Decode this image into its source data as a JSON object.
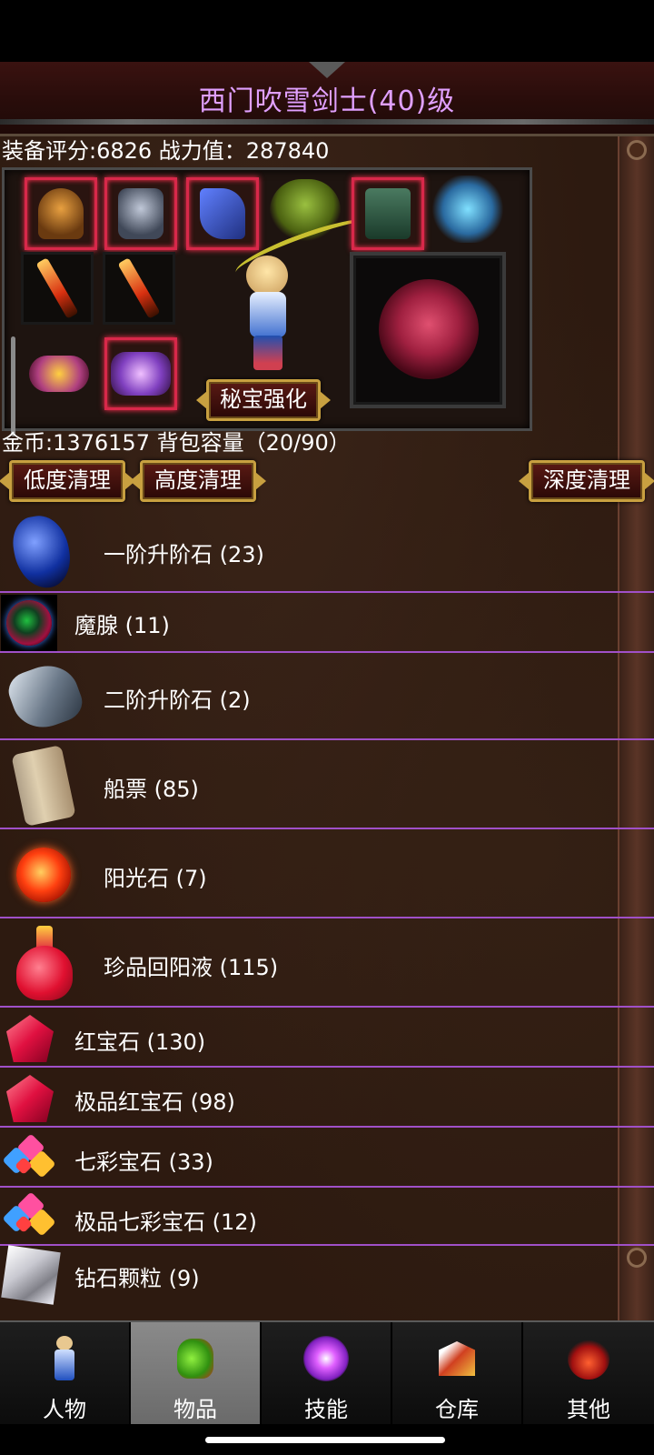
{
  "header": {
    "title": "西门吹雪剑士(40)级"
  },
  "stats": {
    "text": "装备评分:6826 战力值：287840"
  },
  "equipment": {
    "slots": [
      "helmet-icon",
      "armor-icon",
      "bracer-icon",
      "necklace-icon",
      "boots-icon",
      "wings-icon",
      "sword-icon",
      "sword-icon",
      "belt-icon",
      "crown-icon"
    ],
    "soul_icon": "tiger-emblem-icon",
    "treasure_button": "秘宝强化"
  },
  "inventory_summary": {
    "text": "金币:1376157 背包容量（20/90）"
  },
  "cleanup": {
    "low": "低度清理",
    "high": "高度清理",
    "deep": "深度清理"
  },
  "items": [
    {
      "label": "一阶升阶石 (23)",
      "icon": "blue-stone-icon"
    },
    {
      "label": "魔腺 (11)",
      "icon": "dark-orb-icon"
    },
    {
      "label": "二阶升阶石 (2)",
      "icon": "grey-stone-icon"
    },
    {
      "label": "船票 (85)",
      "icon": "scroll-icon"
    },
    {
      "label": "阳光石 (7)",
      "icon": "sun-stone-icon"
    },
    {
      "label": "珍品回阳液 (115)",
      "icon": "red-potion-icon"
    },
    {
      "label": "红宝石 (130)",
      "icon": "ruby-icon"
    },
    {
      "label": "极品红宝石 (98)",
      "icon": "ruby-icon"
    },
    {
      "label": "七彩宝石 (33)",
      "icon": "rainbow-gems-icon"
    },
    {
      "label": "极品七彩宝石 (12)",
      "icon": "rainbow-gems-icon"
    },
    {
      "label": "钻石颗粒 (9)",
      "icon": "diamond-icon"
    }
  ],
  "tabs": [
    {
      "label": "人物",
      "icon": "character-icon",
      "active": false
    },
    {
      "label": "物品",
      "icon": "potion-bag-icon",
      "active": true
    },
    {
      "label": "技能",
      "icon": "skill-orb-icon",
      "active": false
    },
    {
      "label": "仓库",
      "icon": "warehouse-icon",
      "active": false
    },
    {
      "label": "其他",
      "icon": "other-icon",
      "active": false
    }
  ],
  "colors": {
    "title": "#e0a0ff",
    "divider": "#a050c8",
    "slot_glow": "#d8284a",
    "button_border": "#c8a040"
  }
}
